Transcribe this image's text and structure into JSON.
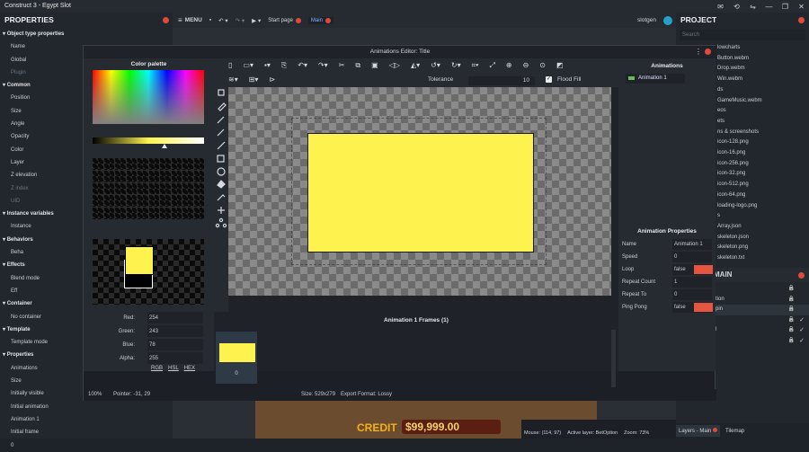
{
  "app": {
    "title": "Construct 3 - Egypt Slot"
  },
  "left_panel": {
    "title": "PROPERTIES",
    "rows": [
      {
        "label": "Object type properties",
        "type": "sec"
      },
      {
        "label": "Name",
        "type": "row"
      },
      {
        "label": "Global",
        "type": "row"
      },
      {
        "label": "Plugin",
        "type": "dim"
      },
      {
        "label": "Common",
        "type": "sec"
      },
      {
        "label": "Position",
        "type": "row"
      },
      {
        "label": "Size",
        "type": "row"
      },
      {
        "label": "Angle",
        "type": "row"
      },
      {
        "label": "Opacity",
        "type": "row"
      },
      {
        "label": "Color",
        "type": "row"
      },
      {
        "label": "Layer",
        "type": "row"
      },
      {
        "label": "Z elevation",
        "type": "row"
      },
      {
        "label": "Z index",
        "type": "dim"
      },
      {
        "label": "UID",
        "type": "dim"
      },
      {
        "label": "Instance variables",
        "type": "sec"
      },
      {
        "label": "Instance",
        "type": "row"
      },
      {
        "label": "Behaviors",
        "type": "sec"
      },
      {
        "label": "Beha",
        "type": "row"
      },
      {
        "label": "Effects",
        "type": "sec"
      },
      {
        "label": "Blend mode",
        "type": "row"
      },
      {
        "label": "Eff",
        "type": "row"
      },
      {
        "label": "Container",
        "type": "sec"
      },
      {
        "label": "No container",
        "type": "row"
      },
      {
        "label": "Template",
        "type": "sec"
      },
      {
        "label": "Template mode",
        "type": "row"
      },
      {
        "label": "Properties",
        "type": "sec"
      },
      {
        "label": "Animations",
        "type": "row"
      },
      {
        "label": "Size",
        "type": "row"
      },
      {
        "label": "Initially visible",
        "type": "row"
      },
      {
        "label": "Initial animation",
        "type": "row"
      },
      {
        "label": "Animation 1",
        "type": "row"
      },
      {
        "label": "Initial frame",
        "type": "row"
      },
      {
        "label": "0",
        "type": "row"
      }
    ]
  },
  "toolbar": {
    "menu": "MENU",
    "start_page": "Start page",
    "main_tab": "Main",
    "user": "slotgen"
  },
  "right_panel": {
    "title": "PROJECT",
    "search_placeholder": "Search",
    "items": [
      "lowcharts",
      "Button.webm",
      "Drop.webm",
      "Win.webm",
      "ds",
      "GameMusic.webm",
      "eos",
      "ets",
      "ns & screenshots",
      "icon-128.png",
      "icon-16.png",
      "icon-256.png",
      "icon-32.png",
      "icon-512.png",
      "icon-64.png",
      "loading-logo.png",
      "s",
      "Array.json",
      "skeleton.json",
      "skeleton.png",
      "skeleton.txt"
    ],
    "layers_title": "MAIN",
    "layers": [
      "",
      "tion",
      "pin",
      "",
      "l",
      ""
    ],
    "bottom_tabs": [
      "Layers - Main",
      "Tilemap"
    ]
  },
  "background": {
    "credit_label": "CREDIT",
    "credit_value": "$99,999.00",
    "mouse": "Mouse: (114, 97)",
    "active_layer": "Active layer: BetOption",
    "zoom": "Zoom: 73%"
  },
  "dialog": {
    "title": "Animations Editor: Title",
    "palette_title": "Color palette",
    "tolerance_label": "Tolerance",
    "tolerance_value": "10",
    "flood_fill_label": "Flood Fill",
    "red_label": "Red:",
    "red": "254",
    "green_label": "Green:",
    "green": "243",
    "blue_label": "Blue:",
    "blue": "78",
    "alpha_label": "Alpha:",
    "alpha": "255",
    "mode_rgb": "RGB",
    "mode_hsl": "HSL",
    "mode_hex": "HEX",
    "frames_title": "Animation 1 Frames (1)",
    "frame_index": "0",
    "animations_title": "Animations",
    "animation_item": "Animation 1",
    "anim_props_title": "Animation Properties",
    "props": {
      "name_label": "Name",
      "name_value": "Animation 1",
      "speed_label": "Speed",
      "speed_value": "0",
      "loop_label": "Loop",
      "loop_value": "false",
      "repeat_count_label": "Repeat Count",
      "repeat_count_value": "1",
      "repeat_to_label": "Repeat To",
      "repeat_to_value": "0",
      "ping_pong_label": "Ping Pong",
      "ping_pong_value": "false"
    },
    "zoom": "100%",
    "pointer": "Pointer: -31, 29",
    "size": "Size: 529x279",
    "export_format": "Export Format: Lossy"
  },
  "colors": {
    "primary": "#fef34e",
    "secondary": "#000000",
    "accent": "#e04a3a"
  }
}
